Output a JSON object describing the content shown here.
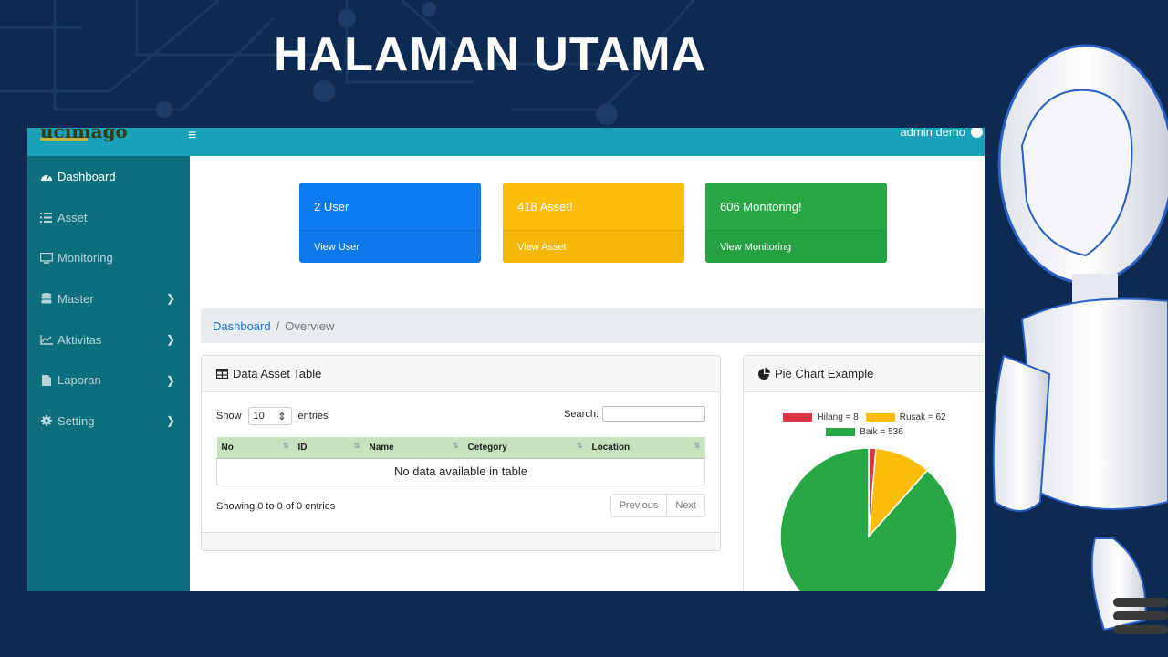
{
  "slide": {
    "title": "HALAMAN UTAMA"
  },
  "header": {
    "brand": "ucimago",
    "menu_icon": "hamburger-icon",
    "user_label": "admin demo"
  },
  "sidebar": {
    "items": [
      {
        "label": "Dashboard",
        "icon": "tachometer-icon",
        "submenu": false
      },
      {
        "label": "Asset",
        "icon": "list-icon",
        "submenu": false
      },
      {
        "label": "Monitoring",
        "icon": "monitor-icon",
        "submenu": false
      },
      {
        "label": "Master",
        "icon": "database-icon",
        "submenu": true
      },
      {
        "label": "Aktivitas",
        "icon": "line-chart-icon",
        "submenu": true
      },
      {
        "label": "Laporan",
        "icon": "file-icon",
        "submenu": true
      },
      {
        "label": "Setting",
        "icon": "gear-icon",
        "submenu": true
      }
    ]
  },
  "cards": [
    {
      "title": "2 User",
      "link": "View User",
      "color": "#0d7cf2"
    },
    {
      "title": "418 Asset!",
      "link": "View Asset",
      "color": "#fbbd08"
    },
    {
      "title": "606 Monitoring!",
      "link": "View Monitoring",
      "color": "#28a745"
    }
  ],
  "breadcrumb": {
    "link": "Dashboard",
    "separator": "/",
    "current": "Overview"
  },
  "table_panel": {
    "title": "Data Asset Table",
    "show_label": "Show",
    "entries_value": "10",
    "entries_label": "entries",
    "search_label": "Search:",
    "columns": [
      "No",
      "ID",
      "Name",
      "Cetegory",
      "Location"
    ],
    "empty_text": "No data available in table",
    "info": "Showing 0 to 0 of 0 entries",
    "prev_label": "Previous",
    "next_label": "Next"
  },
  "pie_panel": {
    "title": "Pie Chart Example",
    "legend": [
      "Hilang = 8",
      "Rusak = 62",
      "Baik = 536"
    ]
  },
  "chart_data": {
    "type": "pie",
    "labels": [
      "Hilang",
      "Rusak",
      "Baik"
    ],
    "values": [
      8,
      62,
      536
    ],
    "colors": [
      "#dc3545",
      "#fbbd08",
      "#28a745"
    ]
  }
}
